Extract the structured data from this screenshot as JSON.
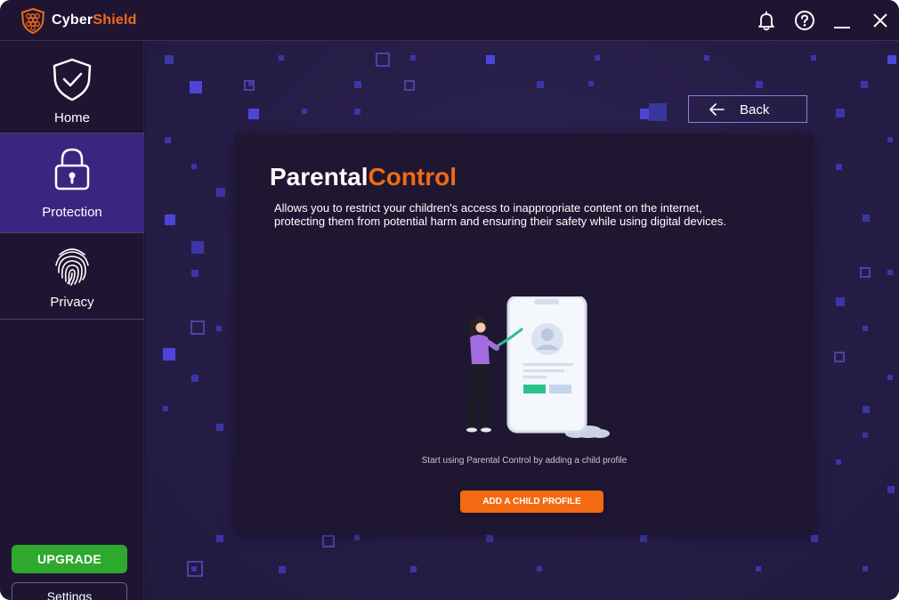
{
  "app": {
    "brand_part1": "Cyber",
    "brand_part2": "Shield",
    "accent_color": "#f26a13"
  },
  "titlebar": {
    "icons": [
      "bell-icon",
      "help-icon",
      "minimize-icon",
      "close-icon"
    ]
  },
  "sidebar": {
    "items": [
      {
        "label": "Home",
        "icon": "shield-check-icon",
        "active": false
      },
      {
        "label": "Protection",
        "icon": "lock-icon",
        "active": true
      },
      {
        "label": "Privacy",
        "icon": "fingerprint-icon",
        "active": false
      }
    ],
    "upgrade_label": "UPGRADE",
    "settings_label": "Settings"
  },
  "main": {
    "back_label": "Back",
    "card": {
      "title_part1": "Parental",
      "title_part2": "Control",
      "description_line1": "Allows you to restrict your children's access to inappropriate content on the internet,",
      "description_line2": "protecting them from potential harm and ensuring their safety while using digital devices.",
      "illustration": "person-with-phone-illustration",
      "hint": "Start using Parental Control by adding a child profile",
      "add_button_label": "ADD A  CHILD PROFILE"
    }
  }
}
